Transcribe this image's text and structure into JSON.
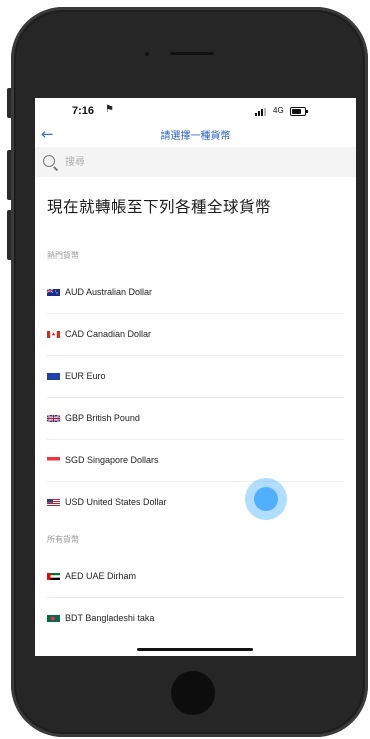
{
  "status_bar": {
    "time": "7:16",
    "network": "4G"
  },
  "header": {
    "back_icon": "back-arrow-icon",
    "title": "請選擇一種貨幣"
  },
  "search": {
    "placeholder": "搜尋"
  },
  "headline": "現在就轉帳至下列各種全球貨幣",
  "popular": {
    "label": "熱門貨幣",
    "items": [
      {
        "label": "AUD Australian Dollar",
        "flag": "au-flag-icon"
      },
      {
        "label": "CAD Canadian Dollar",
        "flag": "ca-flag-icon"
      },
      {
        "label": "EUR Euro",
        "flag": "eu-flag-icon"
      },
      {
        "label": "GBP British Pound",
        "flag": "gb-flag-icon"
      },
      {
        "label": "SGD Singapore Dollars",
        "flag": "sg-flag-icon"
      },
      {
        "label": "USD United States Dollar",
        "flag": "us-flag-icon"
      }
    ]
  },
  "all": {
    "label": "所有貨幣",
    "items": [
      {
        "label": "AED UAE Dirham",
        "flag": "ae-flag-icon"
      },
      {
        "label": "BDT Bangladeshi taka",
        "flag": "bd-flag-icon"
      }
    ]
  },
  "colors": {
    "accent": "#2a5fcf",
    "touch": "#46aaff"
  }
}
